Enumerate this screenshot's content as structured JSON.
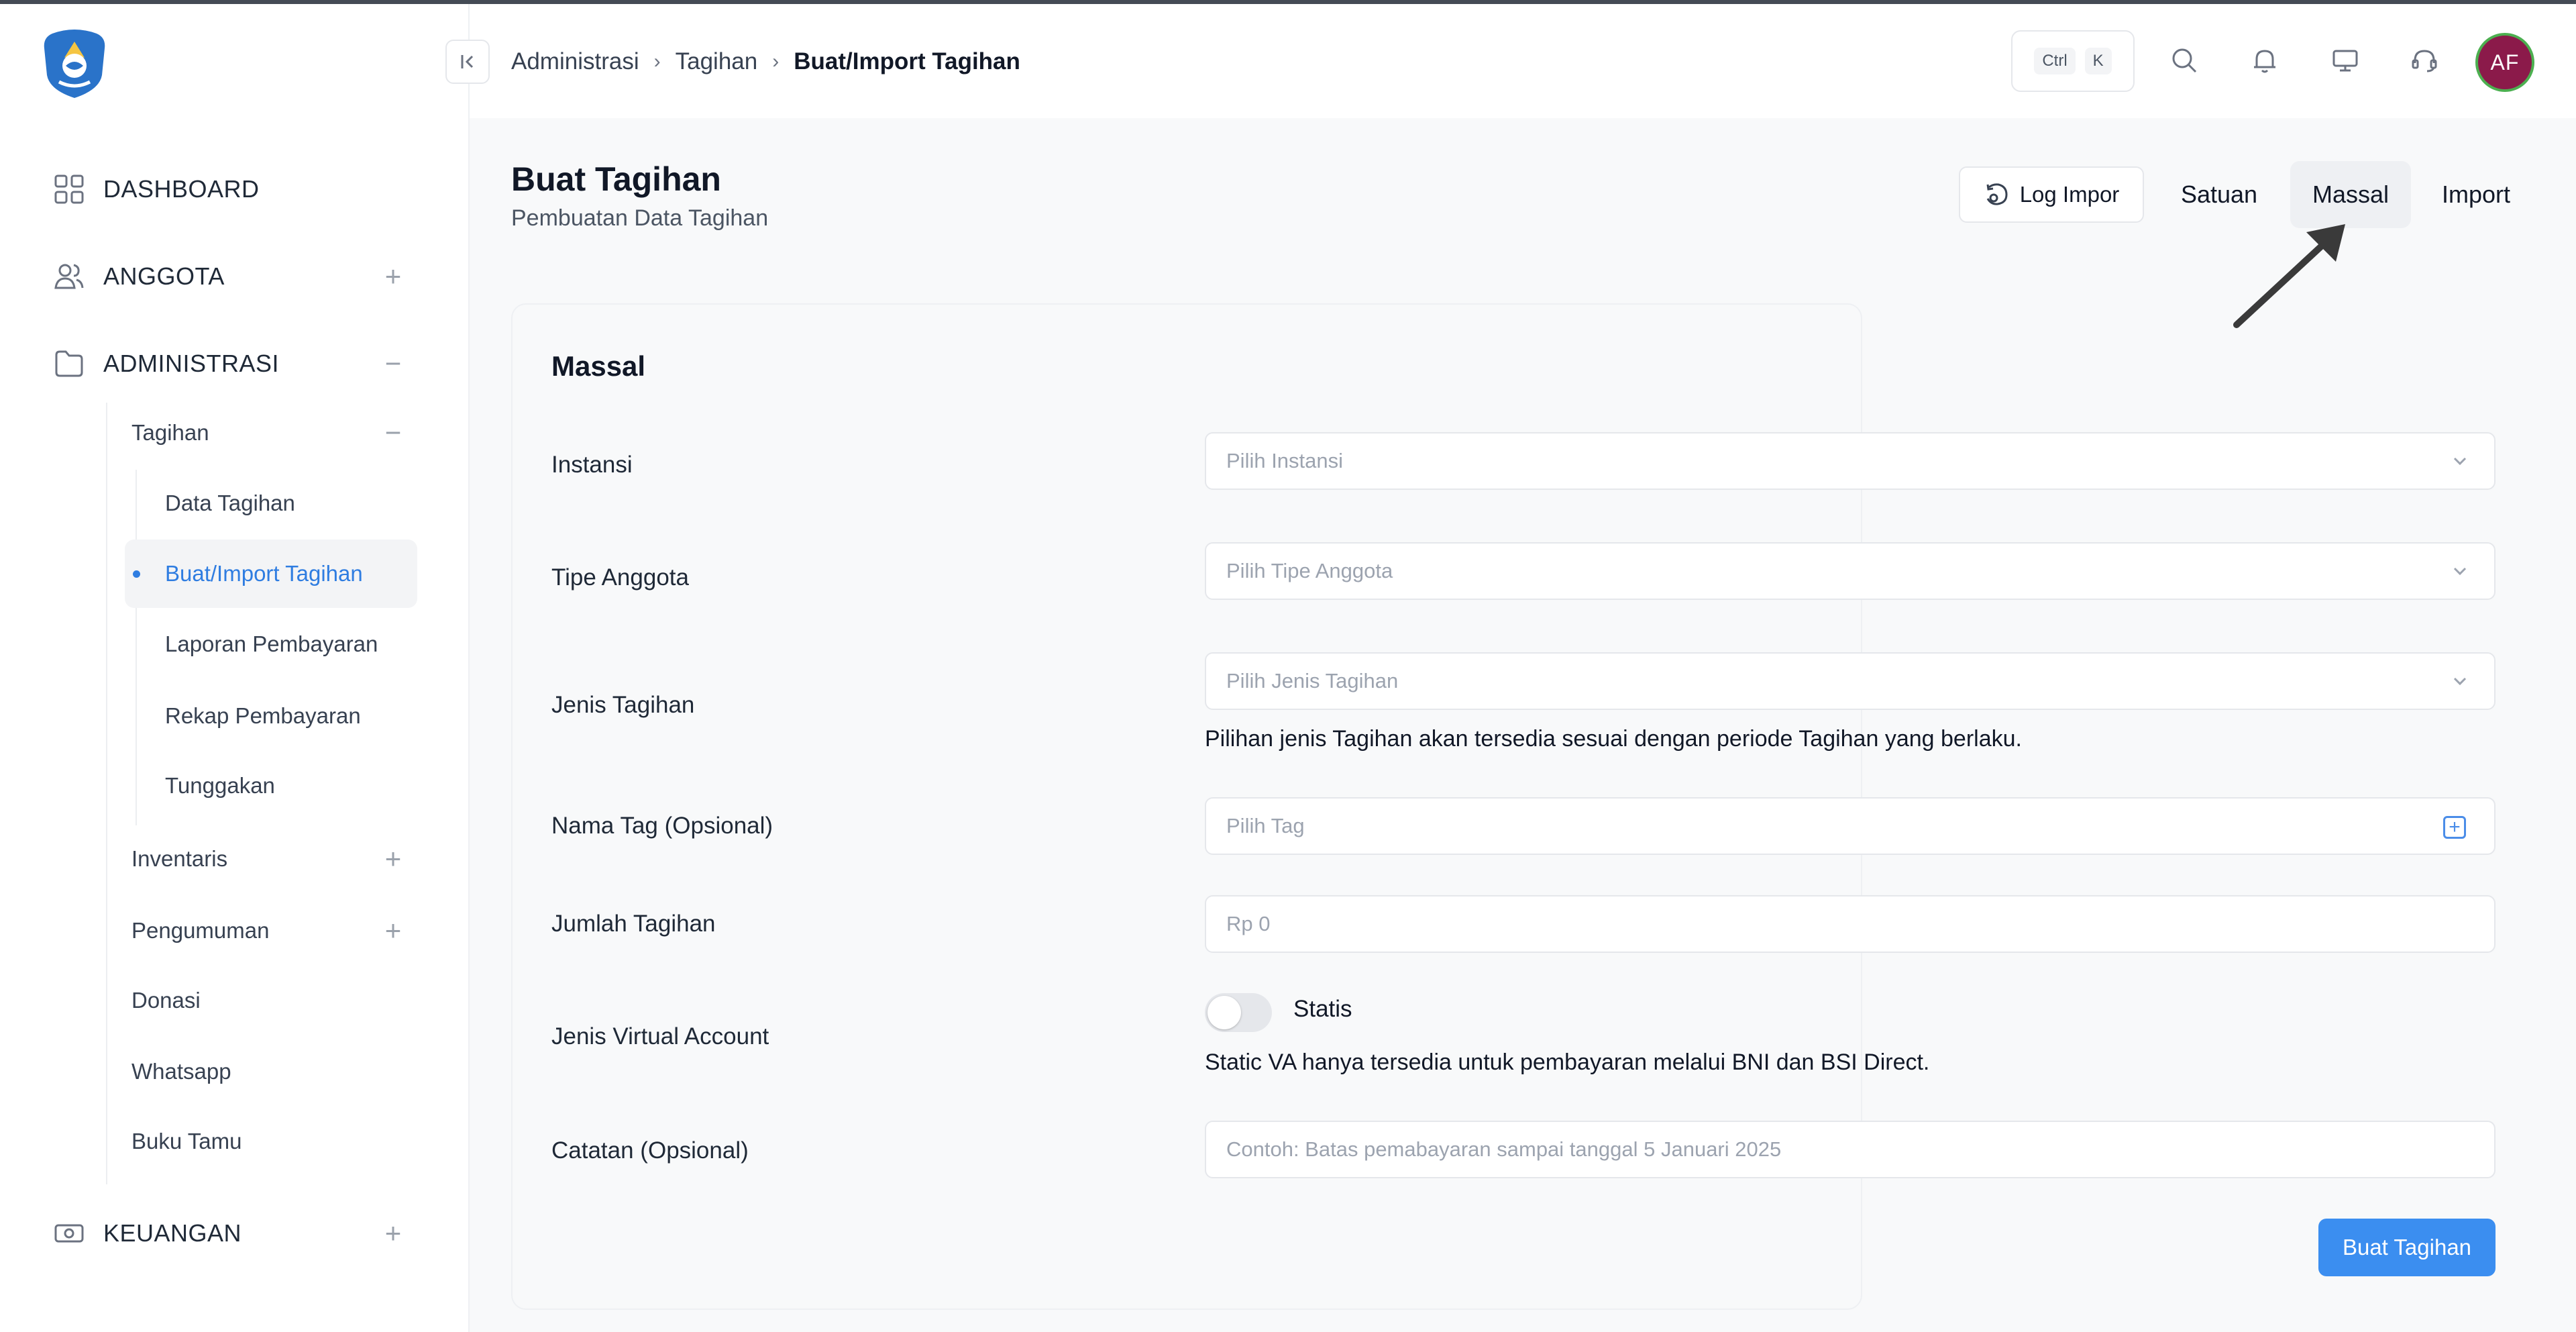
{
  "breadcrumb": [
    "Administrasi",
    "Tagihan",
    "Buat/Import Tagihan"
  ],
  "shortcut": {
    "key1": "Ctrl",
    "key2": "K"
  },
  "user": {
    "initials": "AF"
  },
  "sidebar": {
    "dashboard": "DASHBOARD",
    "anggota": "ANGGOTA",
    "administrasi": "ADMINISTRASI",
    "tagihan": "Tagihan",
    "tagihan_children": [
      "Data Tagihan",
      "Buat/Import Tagihan",
      "Laporan Pembayaran",
      "Rekap Pembayaran",
      "Tunggakan"
    ],
    "admin_children": [
      "Inventaris",
      "Pengumuman",
      "Donasi",
      "Whatsapp",
      "Buku Tamu"
    ],
    "keuangan": "KEUANGAN"
  },
  "page": {
    "title": "Buat Tagihan",
    "subtitle": "Pembuatan Data Tagihan",
    "log_button": "Log Impor",
    "tabs": [
      "Satuan",
      "Massal",
      "Import"
    ],
    "active_tab": "Massal"
  },
  "form": {
    "title": "Massal",
    "instansi": {
      "label": "Instansi",
      "placeholder": "Pilih Instansi"
    },
    "tipe_anggota": {
      "label": "Tipe Anggota",
      "placeholder": "Pilih Tipe Anggota"
    },
    "jenis_tagihan": {
      "label": "Jenis Tagihan",
      "placeholder": "Pilih Jenis Tagihan",
      "helper": "Pilihan jenis Tagihan akan tersedia sesuai dengan periode Tagihan yang berlaku."
    },
    "nama_tag": {
      "label": "Nama Tag (Opsional)",
      "placeholder": "Pilih Tag"
    },
    "jumlah_tagihan": {
      "label": "Jumlah Tagihan",
      "placeholder": "Rp 0"
    },
    "virtual_account": {
      "label": "Jenis Virtual Account",
      "toggle_label": "Statis",
      "toggle_on": false,
      "helper": "Static VA hanya tersedia untuk pembayaran melalui BNI dan BSI Direct."
    },
    "catatan": {
      "label": "Catatan (Opsional)",
      "placeholder": "Contoh: Batas pemabayaran sampai tanggal 5 Januari 2025"
    },
    "submit": "Buat Tagihan"
  },
  "colors": {
    "accent": "#3b8ef0",
    "active_text": "#2f7de1",
    "avatar_bg": "#8b1a4a"
  }
}
